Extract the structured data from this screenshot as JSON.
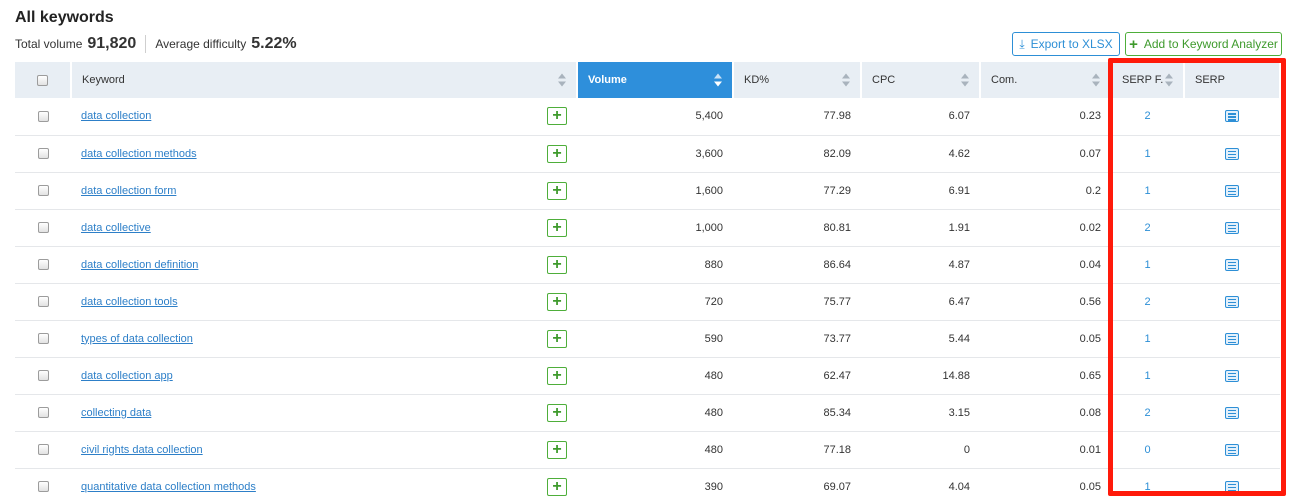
{
  "header": {
    "title": "All keywords",
    "total_volume_label": "Total volume",
    "total_volume_value": "91,820",
    "avg_difficulty_label": "Average difficulty",
    "avg_difficulty_value": "5.22%"
  },
  "actions": {
    "export_label": "Export to XLSX",
    "export_icon": "download-icon",
    "add_label": "Add to Keyword Analyzer",
    "add_icon": "plus-icon"
  },
  "columns": {
    "keyword": "Keyword",
    "volume": "Volume",
    "kd": "KD%",
    "cpc": "CPC",
    "com": "Com.",
    "serp_features": "SERP F.",
    "serp": "SERP"
  },
  "rows": [
    {
      "keyword": "data collection",
      "volume": "5,400",
      "kd": "77.98",
      "cpc": "6.07",
      "com": "0.23",
      "serp_features": "2"
    },
    {
      "keyword": "data collection methods",
      "volume": "3,600",
      "kd": "82.09",
      "cpc": "4.62",
      "com": "0.07",
      "serp_features": "1"
    },
    {
      "keyword": "data collection form",
      "volume": "1,600",
      "kd": "77.29",
      "cpc": "6.91",
      "com": "0.2",
      "serp_features": "1"
    },
    {
      "keyword": "data collective",
      "volume": "1,000",
      "kd": "80.81",
      "cpc": "1.91",
      "com": "0.02",
      "serp_features": "2"
    },
    {
      "keyword": "data collection definition",
      "volume": "880",
      "kd": "86.64",
      "cpc": "4.87",
      "com": "0.04",
      "serp_features": "1"
    },
    {
      "keyword": "data collection tools",
      "volume": "720",
      "kd": "75.77",
      "cpc": "6.47",
      "com": "0.56",
      "serp_features": "2"
    },
    {
      "keyword": "types of data collection",
      "volume": "590",
      "kd": "73.77",
      "cpc": "5.44",
      "com": "0.05",
      "serp_features": "1"
    },
    {
      "keyword": "data collection app",
      "volume": "480",
      "kd": "62.47",
      "cpc": "14.88",
      "com": "0.65",
      "serp_features": "1"
    },
    {
      "keyword": "collecting data",
      "volume": "480",
      "kd": "85.34",
      "cpc": "3.15",
      "com": "0.08",
      "serp_features": "2"
    },
    {
      "keyword": "civil rights data collection",
      "volume": "480",
      "kd": "77.18",
      "cpc": "0",
      "com": "0.01",
      "serp_features": "0"
    },
    {
      "keyword": "quantitative data collection methods",
      "volume": "390",
      "kd": "69.07",
      "cpc": "4.04",
      "com": "0.05",
      "serp_features": "1"
    }
  ],
  "colors": {
    "accent": "#2e8fdb",
    "add_green": "#4eae3a",
    "link": "#2d7fc8",
    "highlight": "#ff1a0a"
  }
}
